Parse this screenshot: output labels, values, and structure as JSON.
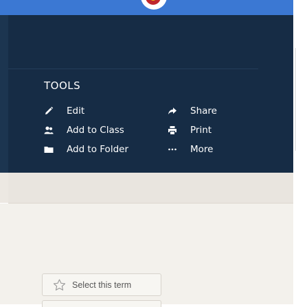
{
  "tools": {
    "heading": "TOOLS",
    "items": [
      {
        "label": "Edit",
        "icon": "pencil-icon"
      },
      {
        "label": "Add to Class",
        "icon": "users-icon"
      },
      {
        "label": "Add to Folder",
        "icon": "folder-icon"
      },
      {
        "label": "Share",
        "icon": "share-icon"
      },
      {
        "label": "Print",
        "icon": "print-icon"
      },
      {
        "label": "More",
        "icon": "more-icon"
      }
    ]
  },
  "term": {
    "select_label": "Select this term",
    "icon": "star-outline-icon"
  },
  "colors": {
    "topbar": "#3b78d3",
    "panel": "#162c45",
    "gray_bar": "#e9e5df",
    "content_bg": "#f3f1ec",
    "text_on_dark": "#ffffff"
  }
}
